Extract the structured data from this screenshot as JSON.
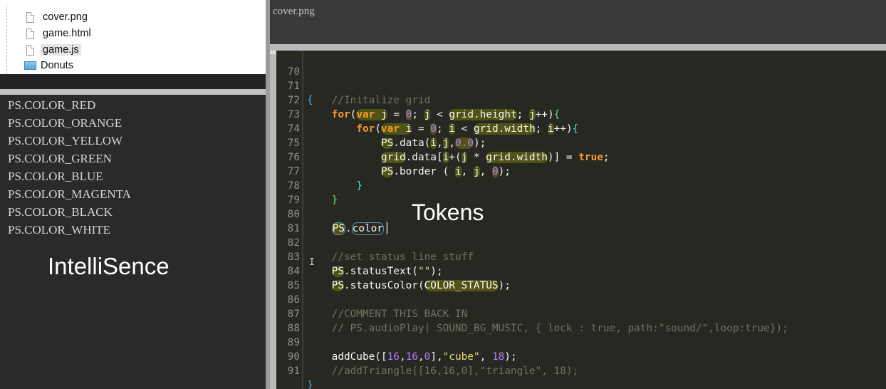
{
  "file_tree": {
    "items": [
      {
        "name": "cover.png",
        "type": "file",
        "icon": "file-icon"
      },
      {
        "name": "game.html",
        "type": "file",
        "icon": "file-icon"
      },
      {
        "name": "game.js",
        "type": "file",
        "icon": "file-icon",
        "selected": true
      },
      {
        "name": "Donuts",
        "type": "folder",
        "icon": "folder-icon"
      }
    ]
  },
  "intellisense": {
    "items": [
      "PS.COLOR_RED",
      "PS.COLOR_ORANGE",
      "PS.COLOR_YELLOW",
      "PS.COLOR_GREEN",
      "PS.COLOR_BLUE",
      "PS.COLOR_MAGENTA",
      "PS.COLOR_BLACK",
      "PS.COLOR_WHITE"
    ],
    "caption": "IntelliSence"
  },
  "editor": {
    "filename": "cover.png",
    "tokens_label": "Tokens",
    "lines": [
      {
        "num": "70",
        "text": ""
      },
      {
        "num": "71",
        "text": "{   //Initalize grid"
      },
      {
        "num": "72",
        "text": "for(var j = 0; j < grid.height; j++){"
      },
      {
        "num": "73",
        "text": "for(var i = 0; i < grid.width; i++){"
      },
      {
        "num": "74",
        "text": "PS.data(i,j,0.0);"
      },
      {
        "num": "75",
        "text": "grid.data[i+(j * grid.width)] = true;"
      },
      {
        "num": "76",
        "text": "PS.border ( i, j, 0);"
      },
      {
        "num": "77",
        "text": "}"
      },
      {
        "num": "78",
        "text": "}"
      },
      {
        "num": "79",
        "text": ""
      },
      {
        "num": "80",
        "text": "PS.color"
      },
      {
        "num": "81",
        "text": ""
      },
      {
        "num": "82",
        "text": "//set status line stuff"
      },
      {
        "num": "83",
        "text": "PS.statusText(\"\");"
      },
      {
        "num": "84",
        "text": "PS.statusColor(COLOR_STATUS);"
      },
      {
        "num": "85",
        "text": ""
      },
      {
        "num": "86",
        "text": "//COMMENT THIS BACK IN"
      },
      {
        "num": "87",
        "text": "// PS.audioPlay( SOUND_BG_MUSIC, { lock : true, path:\"sound/\",loop:true});"
      },
      {
        "num": "88",
        "text": ""
      },
      {
        "num": "89",
        "text": "addCube([16,16,0],\"cube\", 18);"
      },
      {
        "num": "90",
        "text": "//addTriangle([16,16,0],\"triangle\", 18);"
      },
      {
        "num": "91",
        "text": "}"
      }
    ]
  },
  "colors": {
    "editor_bg": "#272822",
    "keyword": "#f99a2a",
    "number": "#ae81ff",
    "string": "#e6db74",
    "comment": "#75715e",
    "highlight": "#4f5318",
    "token_outline": "#5c8dd0"
  }
}
